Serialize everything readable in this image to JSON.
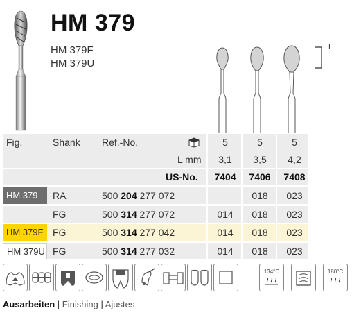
{
  "product": {
    "title": "HM 379",
    "variants": [
      "HM 379F",
      "HM 379U"
    ],
    "length_marker": "L"
  },
  "table": {
    "header": {
      "fig": "Fig.",
      "shank": "Shank",
      "ref": "Ref.-No.",
      "qty_icon": "package-icon",
      "qty": [
        "5",
        "5",
        "5"
      ]
    },
    "length": {
      "label": "L mm",
      "values": [
        "3,1",
        "3,5",
        "4,2"
      ]
    },
    "us": {
      "label": "US-No.",
      "values": [
        "7404",
        "7406",
        "7408"
      ]
    },
    "rows": [
      {
        "fig": "HM 379",
        "shank": "RA",
        "ref_prefix": "500",
        "ref_bold": "204",
        "ref_suffix": "277 072",
        "sizes": [
          "",
          "018",
          "023"
        ],
        "fig_color": "#6e6e6e"
      },
      {
        "fig": "",
        "shank": "FG",
        "ref_prefix": "500",
        "ref_bold": "314",
        "ref_suffix": "277 072",
        "sizes": [
          "014",
          "018",
          "023"
        ]
      },
      {
        "fig": "HM 379F",
        "shank": "FG",
        "ref_prefix": "500",
        "ref_bold": "314",
        "ref_suffix": "277 042",
        "sizes": [
          "014",
          "018",
          "023"
        ],
        "fig_color": "#ffd500"
      },
      {
        "fig": "HM 379U",
        "shank": "FG",
        "ref_prefix": "500",
        "ref_bold": "314",
        "ref_suffix": "277 032",
        "sizes": [
          "014",
          "018",
          "023"
        ]
      }
    ]
  },
  "icons": [
    {
      "name": "crown-prep-icon"
    },
    {
      "name": "orthodontic-icon"
    },
    {
      "name": "cavity-icon"
    },
    {
      "name": "filling-icon"
    },
    {
      "name": "tooth-section-icon"
    },
    {
      "name": "implant-icon"
    },
    {
      "name": "bridge-icon"
    },
    {
      "name": "veneer-icon"
    },
    {
      "name": "sterilize-134-icon",
      "label": "134°C"
    },
    {
      "name": "washer-disinfector-icon"
    },
    {
      "name": "sterilize-180-icon",
      "label": "180°C"
    }
  ],
  "footer": {
    "primary": "Ausarbeiten",
    "sep": "|",
    "secondary": "Finishing",
    "tertiary": "Ajustes"
  }
}
